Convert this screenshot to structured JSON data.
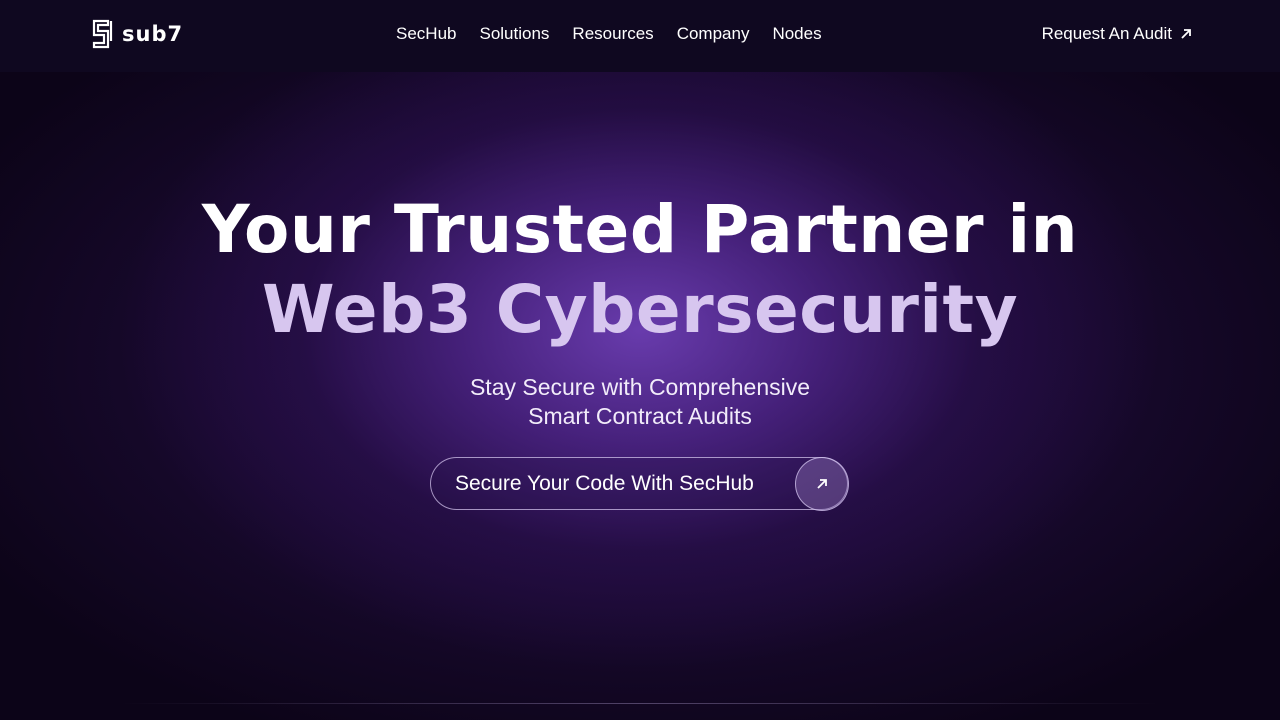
{
  "brand": {
    "logo_text": "sub7",
    "logo_icon": "sub7-logo-icon"
  },
  "nav": {
    "items": [
      {
        "label": "SecHub"
      },
      {
        "label": "Solutions"
      },
      {
        "label": "Resources"
      },
      {
        "label": "Company"
      },
      {
        "label": "Nodes"
      }
    ],
    "cta_label": "Request An Audit",
    "cta_icon": "arrow-up-right-icon"
  },
  "hero": {
    "title_line_1": "Your Trusted Partner in",
    "title_line_2": "Web3 Cybersecurity",
    "subtitle_line_1": "Stay Secure with Comprehensive",
    "subtitle_line_2": "Smart Contract Audits",
    "button_label": "Secure Your Code With SecHub",
    "button_icon": "arrow-up-right-icon"
  },
  "colors": {
    "background": "#0c0418",
    "glow": "#6c3eb2",
    "title_accent": "#d7c6ef",
    "text": "#ffffff"
  }
}
